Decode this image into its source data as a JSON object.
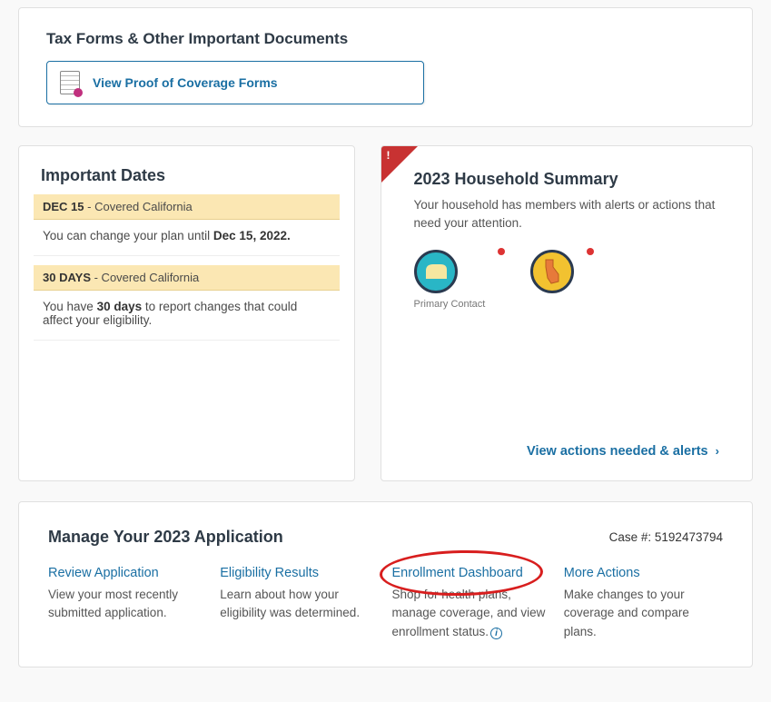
{
  "tax": {
    "title": "Tax Forms & Other Important Documents",
    "proof_link": "View Proof of Coverage Forms"
  },
  "dates": {
    "title": "Important Dates",
    "items": [
      {
        "banner_bold": "DEC 15",
        "banner_rest": " - Covered California",
        "detail_pre": "You can change your plan until ",
        "detail_bold": "Dec 15, 2022.",
        "detail_post": ""
      },
      {
        "banner_bold": "30 DAYS",
        "banner_rest": " - Covered California",
        "detail_pre": "You have ",
        "detail_bold": "30 days",
        "detail_post": " to report changes that could affect your eligibility."
      }
    ]
  },
  "summary": {
    "title": "2023 Household Summary",
    "subtitle": "Your household has members with alerts or actions that need your attention.",
    "primary_contact_label": "Primary Contact",
    "actions_link": "View actions needed & alerts"
  },
  "manage": {
    "title": "Manage Your 2023 Application",
    "case_label": "Case #: ",
    "case_number": "5192473794",
    "columns": [
      {
        "link": "Review Application",
        "desc": "View your most recently submitted application."
      },
      {
        "link": "Eligibility Results",
        "desc": "Learn about how your eligibility was determined."
      },
      {
        "link": "Enrollment Dashboard",
        "desc": "Shop for health plans, manage coverage, and view enrollment status."
      },
      {
        "link": "More Actions",
        "desc": "Make changes to your coverage and compare plans."
      }
    ]
  }
}
